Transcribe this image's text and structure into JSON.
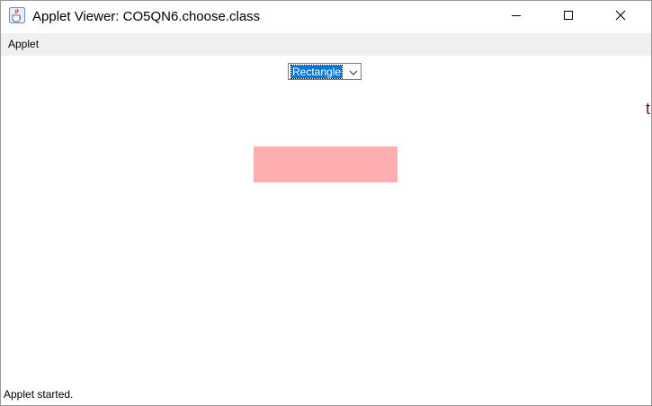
{
  "window": {
    "title": "Applet Viewer: CO5QN6.choose.class",
    "icon": "java-cup-icon"
  },
  "window_controls": {
    "minimize_icon": "minimize-icon",
    "maximize_icon": "maximize-icon",
    "close_icon": "close-icon"
  },
  "menubar": {
    "items": [
      {
        "label": "Applet"
      }
    ]
  },
  "choice": {
    "selected": "Rectangle",
    "arrow_icon": "chevron-down-icon",
    "highlight_color": "#0078d7"
  },
  "canvas": {
    "shape": "rectangle",
    "fill_color": "#ffaeb0"
  },
  "status": {
    "text": "Applet started."
  },
  "background": {
    "edge_glyph": "t"
  }
}
